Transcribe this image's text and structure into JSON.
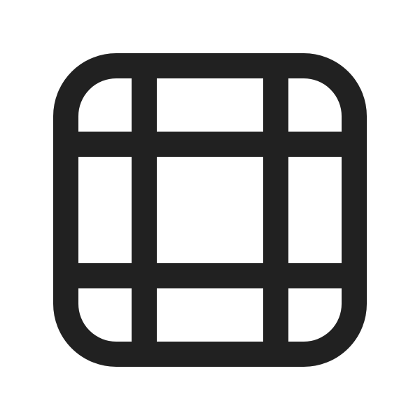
{
  "icon": {
    "name": "grid-3x3-icon",
    "color": "#212121",
    "background": "#ffffff"
  }
}
